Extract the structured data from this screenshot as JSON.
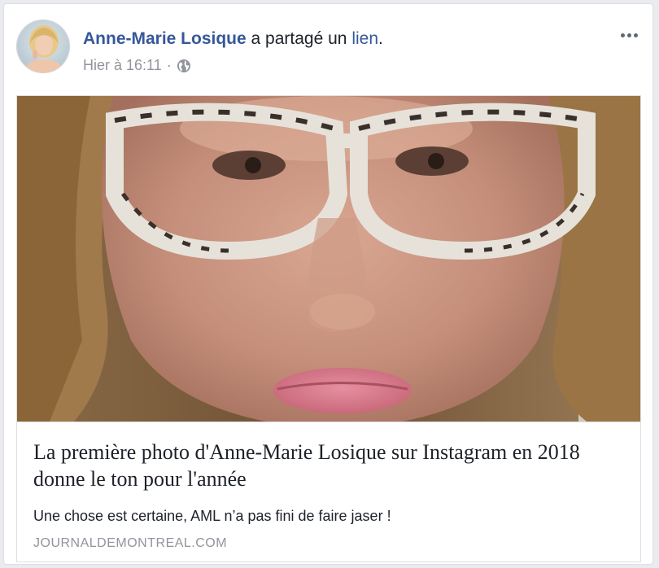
{
  "post": {
    "author_name": "Anne-Marie Losique",
    "action_text": " a partagé un ",
    "action_link": "lien",
    "action_end": ".",
    "timestamp": "Hier à 16:11",
    "separator": "·",
    "audience_icon": "globe-icon",
    "more_icon": "more-options-icon"
  },
  "link_card": {
    "title": "La première photo d'Anne-Marie Losique sur Instagram en 2018 donne le ton pour l'année",
    "description": "Une chose est certaine, AML n’a pas fini de faire jaser !",
    "domain": "JOURNALDEMONTREAL.COM"
  },
  "colors": {
    "link_blue": "#365899",
    "meta_gray": "#90949c",
    "text_dark": "#1d2129",
    "border": "#dddfe2",
    "background": "#e9ebee"
  }
}
